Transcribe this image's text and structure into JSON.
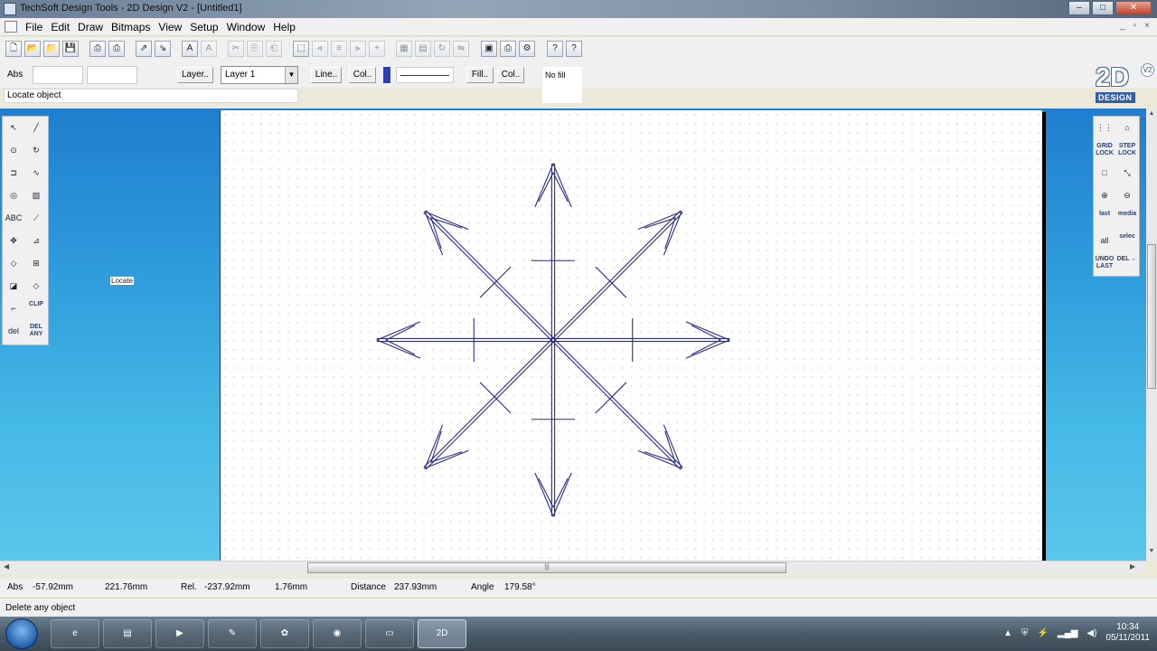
{
  "window": {
    "title": "TechSoft Design Tools - 2D Design V2 - [Untitled1]",
    "controls": [
      "–",
      "□",
      "✕"
    ]
  },
  "menu": {
    "items": [
      "File",
      "Edit",
      "Draw",
      "Bitmaps",
      "View",
      "Setup",
      "Window",
      "Help"
    ]
  },
  "toolbar": {
    "icons": [
      "new-icon",
      "open-icon",
      "open-folder-icon",
      "save-icon",
      "print-icon",
      "print-preview-icon",
      "export-icon",
      "import-icon",
      "text-icon",
      "text-style-icon",
      "cut-icon",
      "copy-icon",
      "paste-icon",
      "select-icon",
      "align-left-icon",
      "align-center-icon",
      "align-right-icon",
      "distribute-icon",
      "group-icon",
      "ungroup-icon",
      "rotate-icon",
      "mirror-icon",
      "fill-area-icon",
      "printer-icon",
      "settings-icon",
      "context-help-icon",
      "help-icon"
    ]
  },
  "props": {
    "abs_label": "Abs",
    "layer_button": "Layer..",
    "layer_value": "Layer 1",
    "line_button": "Line..",
    "col_button": "Col..",
    "fill_button": "Fill..",
    "fill_col_button": "Col..",
    "fill_value": "No fill"
  },
  "hint": "Locate object",
  "logo": {
    "text": "2D",
    "version": "V2",
    "word": "DESIGN"
  },
  "left_tools": [
    {
      "name": "select-arrow-tool",
      "label": "↖"
    },
    {
      "name": "line-tool",
      "label": "╱"
    },
    {
      "name": "circle-tool",
      "label": "⊙"
    },
    {
      "name": "arc-tool",
      "label": "↻"
    },
    {
      "name": "rectangle-tool",
      "label": "⊐"
    },
    {
      "name": "curve-tool",
      "label": "∿"
    },
    {
      "name": "offset-tool",
      "label": "◎"
    },
    {
      "name": "hatch-tool",
      "label": "▨"
    },
    {
      "name": "text-tool",
      "label": "ABC"
    },
    {
      "name": "dimension-tool",
      "label": "⟋"
    },
    {
      "name": "move-tool",
      "label": "✥"
    },
    {
      "name": "trim-tool",
      "label": "⊿"
    },
    {
      "name": "symbol-tool",
      "label": "◇"
    },
    {
      "name": "array-tool",
      "label": "⊞"
    },
    {
      "name": "node-tool",
      "label": "◪"
    },
    {
      "name": "erase-tool",
      "label": "◇"
    },
    {
      "name": "clip-tool",
      "label": "⌐"
    },
    {
      "name": "clip-image-tool",
      "label": "CLIP"
    },
    {
      "name": "delete-last-tool",
      "label": "del"
    },
    {
      "name": "delete-any-tool",
      "label": "DEL ANY"
    }
  ],
  "right_tools": [
    {
      "name": "grid-tool",
      "label": "⋮⋮"
    },
    {
      "name": "pick-tool",
      "label": "⌂"
    },
    {
      "name": "grid-lock-tool",
      "label": "GRID LOCK"
    },
    {
      "name": "step-lock-tool",
      "label": "STEP LOCK"
    },
    {
      "name": "window-zoom-tool",
      "label": "□"
    },
    {
      "name": "pan-tool",
      "label": "⤡"
    },
    {
      "name": "zoom-in-tool",
      "label": "⊕"
    },
    {
      "name": "zoom-out-tool",
      "label": "⊖"
    },
    {
      "name": "zoom-last-tool",
      "label": "last"
    },
    {
      "name": "zoom-media-tool",
      "label": "media"
    },
    {
      "name": "zoom-all-tool",
      "label": "all"
    },
    {
      "name": "zoom-selection-tool",
      "label": "selec"
    },
    {
      "name": "undo-last-tool",
      "label": "UNDO LAST"
    },
    {
      "name": "del-back-tool",
      "label": "DEL ←"
    }
  ],
  "cursor_tip": "Locate",
  "coords": {
    "abs_label": "Abs",
    "abs_x": "-57.92mm",
    "abs_y": "221.76mm",
    "rel_label": "Rel.",
    "rel_x": "-237.92mm",
    "rel_y": "1.76mm",
    "distance_label": "Distance",
    "distance": "237.93mm",
    "angle_label": "Angle",
    "angle": "179.58°"
  },
  "status": "Delete any object",
  "taskbar": {
    "apps": [
      "ie-icon",
      "explorer-icon",
      "media-player-icon",
      "paint-icon",
      "network-icon",
      "chrome-icon",
      "file-manager-icon",
      "2d-design-icon"
    ],
    "active_app_label": "2D",
    "time": "10:34",
    "date": "05/11/2011"
  },
  "colors": {
    "drawing_stroke": "#2b2b8a",
    "workspace_top": "#1f7ecf",
    "workspace_bottom": "#5ac6ec"
  }
}
